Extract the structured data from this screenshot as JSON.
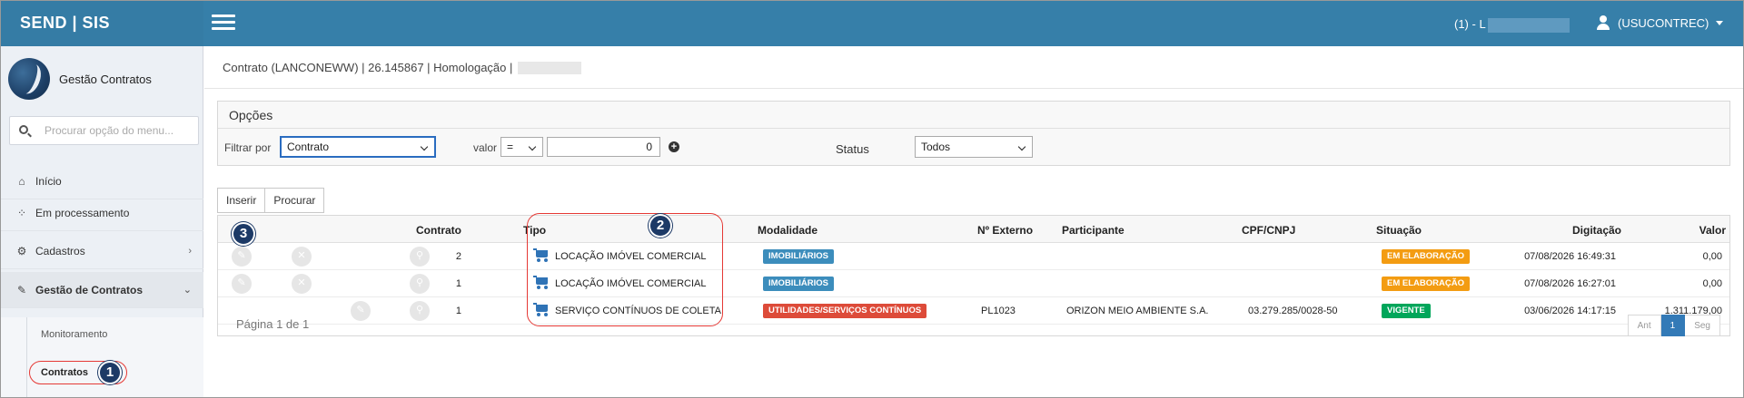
{
  "brand": "SEND | SIS",
  "header": {
    "env_label": "(1) - L",
    "user_label": "(USUCONTREC)"
  },
  "sidebar": {
    "title": "Gestão Contratos",
    "search_placeholder": "Procurar opção do menu...",
    "items": [
      {
        "label": "Início",
        "icon": "home-icon"
      },
      {
        "label": "Em processamento",
        "icon": "spinner-icon"
      },
      {
        "label": "Cadastros",
        "icon": "gears-icon"
      },
      {
        "label": "Gestão de Contratos",
        "icon": "edit-icon"
      }
    ],
    "subitems": [
      {
        "label": "Monitoramento"
      },
      {
        "label": "Contratos"
      }
    ]
  },
  "breadcrumb": "Contrato (LANCONEWW) | 26.145867 | Homologação |",
  "options": {
    "title": "Opções",
    "filter_label": "Filtrar por",
    "filter_value": "Contrato",
    "value_label": "valor",
    "operator": "=",
    "number": "0",
    "status_label": "Status",
    "status_value": "Todos"
  },
  "buttons": {
    "insert": "Inserir",
    "search": "Procurar"
  },
  "table": {
    "columns": [
      "Contrato",
      "Tipo",
      "Modalidade",
      "Nº Externo",
      "Participante",
      "CPF/CNPJ",
      "Situação",
      "Digitação",
      "Valor"
    ],
    "rows": [
      {
        "contrato": "2",
        "tipo": "LOCAÇÃO IMÓVEL COMERCIAL",
        "modalidade": "IMOBILIÁRIOS",
        "externo": "",
        "participante": "",
        "cnpj": "",
        "situacao": "EM ELABORAÇÃO",
        "digitacao": "07/08/2026 16:49:31",
        "valor": "0,00"
      },
      {
        "contrato": "1",
        "tipo": "LOCAÇÃO IMÓVEL COMERCIAL",
        "modalidade": "IMOBILIÁRIOS",
        "externo": "",
        "participante": "",
        "cnpj": "",
        "situacao": "EM ELABORAÇÃO",
        "digitacao": "07/08/2026 16:27:01",
        "valor": "0,00"
      },
      {
        "contrato": "1",
        "tipo": "SERVIÇO CONTÍNUOS DE COLETA",
        "modalidade": "UTILIDADES/SERVIÇOS CONTÍNUOS",
        "externo": "PL1023",
        "participante": "ORIZON MEIO AMBIENTE S.A.",
        "cnpj": "03.279.285/0028-50",
        "situacao": "VIGENTE",
        "digitacao": "03/06/2026 14:17:15",
        "valor": "1.311.179,00"
      }
    ]
  },
  "pagination": {
    "info": "Página 1 de 1",
    "prev": "Ant",
    "current": "1",
    "next": "Seg"
  },
  "annotations": [
    "1",
    "2",
    "3"
  ],
  "colors": {
    "topbar": "#367fa9",
    "blue_pill": "#3c8dbc",
    "red_pill": "#dd4b39",
    "orange_pill": "#f39c12",
    "green_pill": "#00a65a",
    "annotation_ring": "#e53935",
    "annotation_badge": "#1d3a66"
  }
}
